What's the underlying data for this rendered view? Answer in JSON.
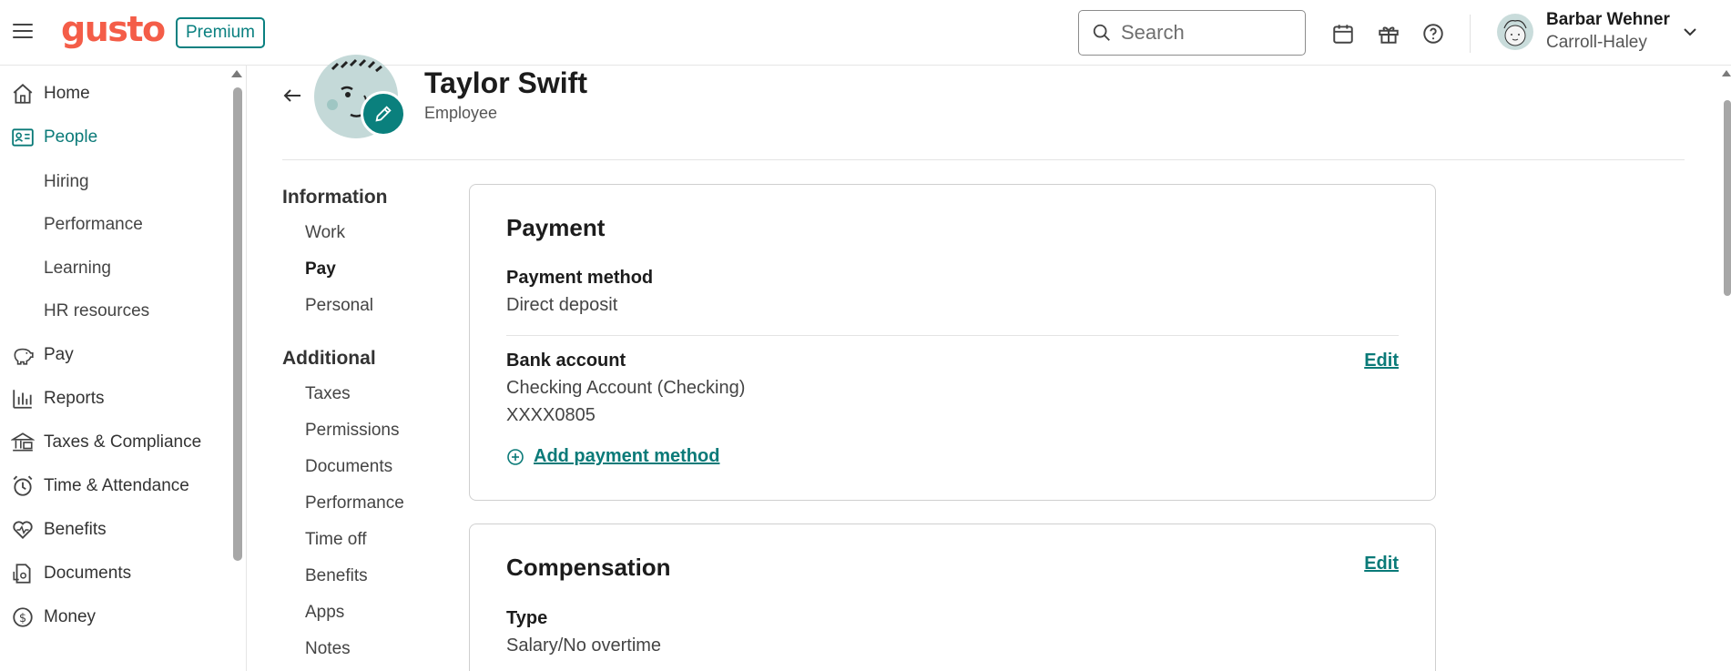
{
  "header": {
    "logo": "gusto",
    "plan_badge": "Premium",
    "search_placeholder": "Search",
    "user_name": "Barbar Wehner",
    "company": "Carroll-Haley",
    "icons": [
      "menu-icon",
      "calendar-icon",
      "gift-icon",
      "help-icon",
      "chevron-down-icon"
    ]
  },
  "nav": {
    "items": [
      {
        "label": "Home",
        "icon": "home-icon"
      },
      {
        "label": "People",
        "icon": "people-icon",
        "active": true
      },
      {
        "label": "Hiring"
      },
      {
        "label": "Performance"
      },
      {
        "label": "Learning"
      },
      {
        "label": "HR resources"
      },
      {
        "label": "Pay",
        "icon": "piggy-bank-icon"
      },
      {
        "label": "Reports",
        "icon": "reports-icon"
      },
      {
        "label": "Taxes & Compliance",
        "icon": "bank-icon"
      },
      {
        "label": "Time & Attendance",
        "icon": "clock-icon"
      },
      {
        "label": "Benefits",
        "icon": "heart-icon"
      },
      {
        "label": "Documents",
        "icon": "documents-icon"
      },
      {
        "label": "Money",
        "icon": "dollar-icon"
      }
    ]
  },
  "employee": {
    "name": "Taylor Swift",
    "role": "Employee"
  },
  "sections": {
    "information": {
      "title": "Information",
      "links": [
        "Work",
        "Pay",
        "Personal"
      ],
      "current": "Pay"
    },
    "additional": {
      "title": "Additional",
      "links": [
        "Taxes",
        "Permissions",
        "Documents",
        "Performance",
        "Time off",
        "Benefits",
        "Apps",
        "Notes"
      ]
    }
  },
  "payment": {
    "title": "Payment",
    "method_label": "Payment method",
    "method_value": "Direct deposit",
    "bank_label": "Bank account",
    "bank_type": "Checking Account (Checking)",
    "bank_number": "XXXX0805",
    "edit_label": "Edit",
    "add_method_label": "Add payment method"
  },
  "compensation": {
    "title": "Compensation",
    "edit_label": "Edit",
    "type_label": "Type",
    "type_value": "Salary/No overtime"
  },
  "colors": {
    "brand": "#f45d48",
    "accent": "#0a7a78"
  }
}
